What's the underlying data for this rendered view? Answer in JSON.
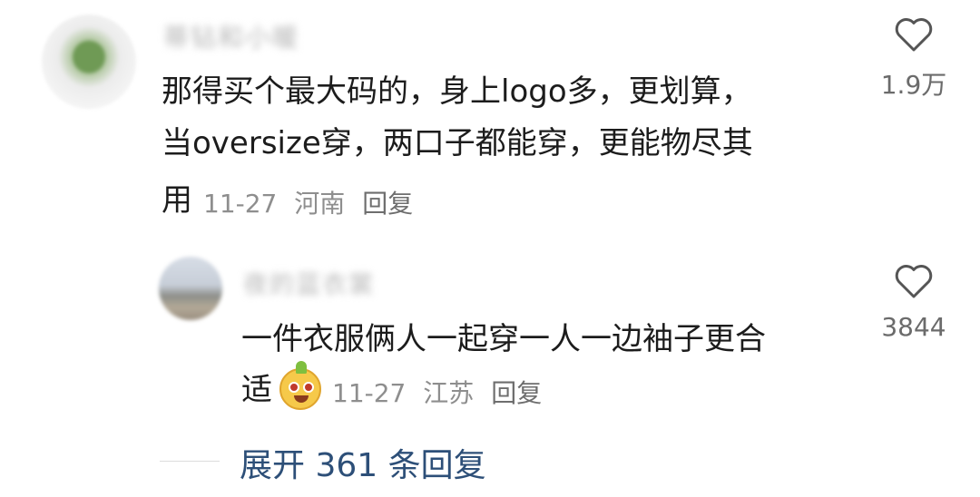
{
  "main_comment": {
    "username": "蒂钻和小暖",
    "text_lines": [
      "那得买个最大码的，身上logo多，更划算，",
      "当oversize穿，两口子都能穿，更能物尽其",
      "用"
    ],
    "date": "11-27",
    "location": "河南",
    "reply_label": "回复",
    "like_count": "1.9万",
    "like_icon": "heart-outline-icon"
  },
  "reply_comment": {
    "username": "夜的蓝衣裳",
    "text_lines": [
      "一件衣服俩人一起穿一人一边袖子更合",
      "适"
    ],
    "emoji": "smiling-fruit-emoji",
    "date": "11-27",
    "location": "江苏",
    "reply_label": "回复",
    "like_count": "3844",
    "like_icon": "heart-outline-icon"
  },
  "expand_replies": {
    "label": "展开 361 条回复"
  },
  "colors": {
    "text": "#1c1c1c",
    "meta": "#8e8e8e",
    "link": "#2d4f78",
    "background": "#ffffff"
  }
}
